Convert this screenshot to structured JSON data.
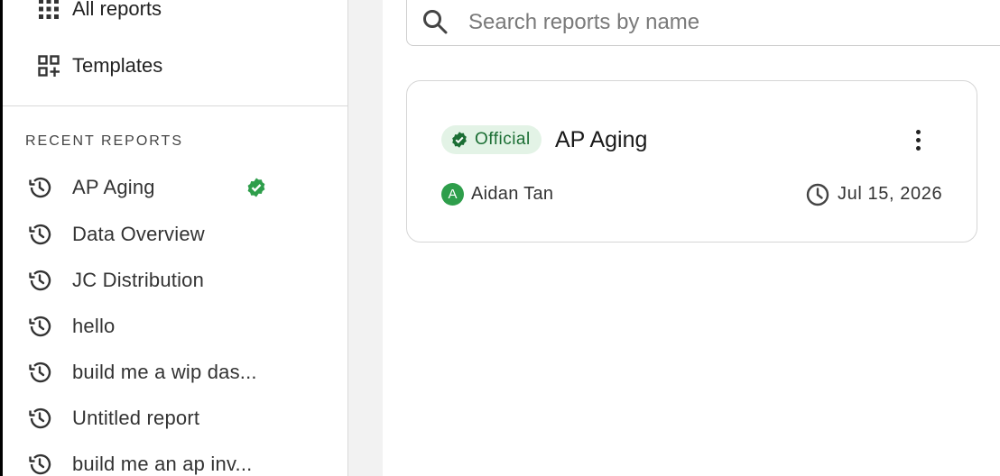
{
  "sidebar": {
    "nav": [
      {
        "label": "All reports",
        "icon": "grid-icon"
      },
      {
        "label": "Templates",
        "icon": "template-add-icon"
      }
    ],
    "recent_title": "RECENT REPORTS",
    "recent": [
      {
        "label": "AP Aging",
        "official": true
      },
      {
        "label": "Data Overview"
      },
      {
        "label": "JC Distribution"
      },
      {
        "label": "hello"
      },
      {
        "label": "build me a wip das..."
      },
      {
        "label": "Untitled report"
      },
      {
        "label": "build me an ap inv..."
      }
    ]
  },
  "search": {
    "placeholder": "Search reports by name",
    "value": ""
  },
  "card": {
    "badge": "Official",
    "title": "AP Aging",
    "author_initial": "A",
    "author": "Aidan Tan",
    "date": "Jul 15, 2026"
  },
  "colors": {
    "verified": "#2e9e4b",
    "badge_bg": "#e3f3e6",
    "badge_text": "#1b6e34"
  }
}
